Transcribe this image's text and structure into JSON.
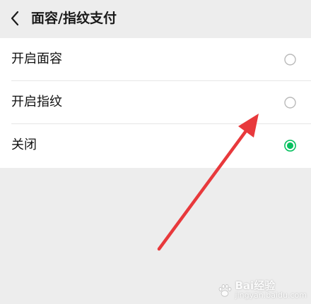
{
  "header": {
    "back_icon": "chevron-left-icon",
    "title": "面容/指纹支付"
  },
  "options": [
    {
      "label": "开启面容",
      "selected": false
    },
    {
      "label": "开启指纹",
      "selected": false
    },
    {
      "label": "关闭",
      "selected": true
    }
  ],
  "colors": {
    "accent": "#07c160",
    "annotation_arrow": "#e8393c",
    "background": "#ededed",
    "card": "#ffffff"
  },
  "watermark": {
    "brand": "Bai",
    "brand_suffix": "经验",
    "domain": "jingyan.baidu.com"
  }
}
